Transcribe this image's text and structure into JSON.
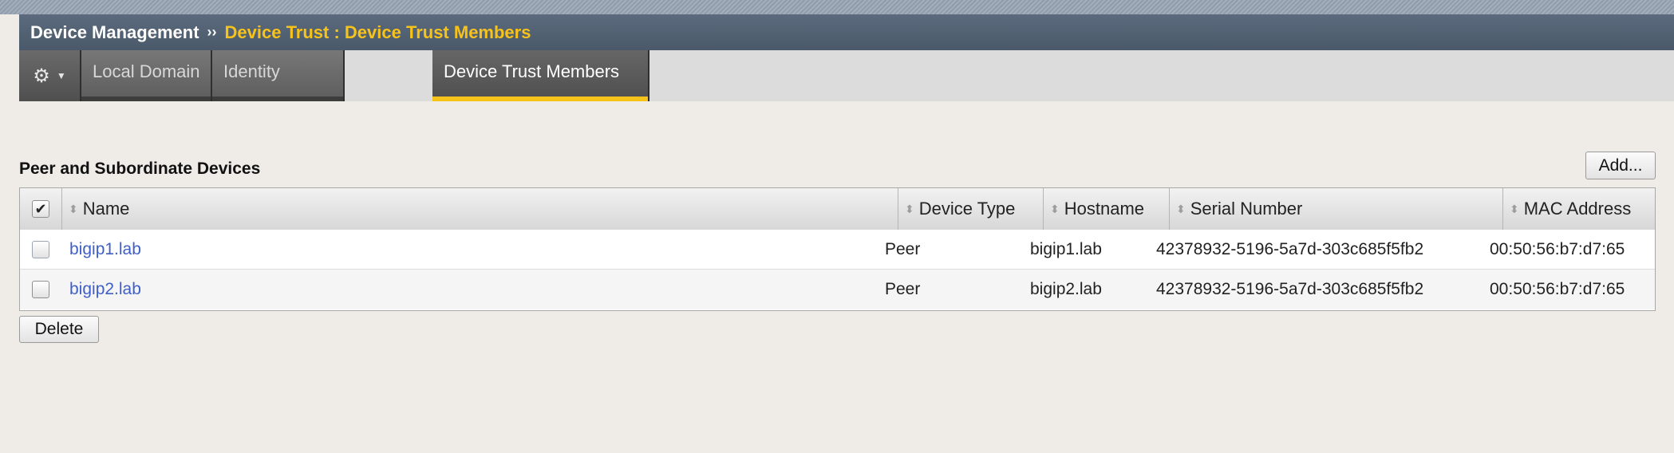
{
  "breadcrumb": {
    "home": "Device Management",
    "separator": "››",
    "current": "Device Trust : Device Trust Members"
  },
  "tabs": {
    "gear_icon": "gear-icon",
    "items": [
      {
        "label": "Local Domain"
      },
      {
        "label": "Identity"
      },
      {
        "label": "Device Trust Members",
        "active": true
      }
    ]
  },
  "section": {
    "title": "Peer and Subordinate Devices",
    "add_label": "Add...",
    "delete_label": "Delete"
  },
  "table": {
    "columns": [
      "Name",
      "Device Type",
      "Hostname",
      "Serial Number",
      "MAC Address"
    ],
    "header_checked": true,
    "rows": [
      {
        "name": "bigip1.lab",
        "device_type": "Peer",
        "hostname": "bigip1.lab",
        "serial": "42378932-5196-5a7d-303c685f5fb2",
        "mac": "00:50:56:b7:d7:65"
      },
      {
        "name": "bigip2.lab",
        "device_type": "Peer",
        "hostname": "bigip2.lab",
        "serial": "42378932-5196-5a7d-303c685f5fb2",
        "mac": "00:50:56:b7:d7:65"
      }
    ]
  },
  "colors": {
    "accent": "#f7c31a",
    "link": "#3f5fc8",
    "header_bar": "#4f5e6f"
  }
}
